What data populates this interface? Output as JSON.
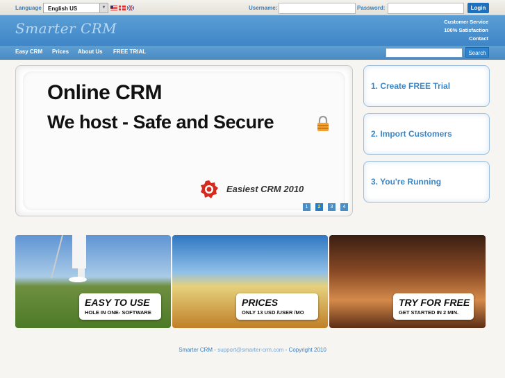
{
  "topbar": {
    "language_label": "Language",
    "language_value": "English US",
    "username_label": "Username:",
    "password_label": "Password:",
    "login_label": "Login"
  },
  "header": {
    "logo_text": "Smarter CRM",
    "links": [
      "Customer Service",
      "100% Satisfaction",
      "Contact"
    ]
  },
  "nav": {
    "items": [
      "Easy CRM",
      "Prices",
      "About Us",
      "FREE TRIAL"
    ],
    "search_label": "Search"
  },
  "slider": {
    "headline1": "Online CRM",
    "headline2": "We host - Safe and Secure",
    "tagline": "Easiest CRM 2010",
    "pages": [
      "1",
      "2",
      "3",
      "4"
    ],
    "active_page": 2
  },
  "steps": [
    "1. Create FREE Trial",
    "2. Import Customers",
    "3. You're Running"
  ],
  "panels": [
    {
      "title": "EASY TO USE",
      "subtitle": "HOLE IN ONE- SOFTWARE"
    },
    {
      "title": "PRICES",
      "subtitle": "ONLY 13 USD /USER /MO"
    },
    {
      "title": "TRY FOR FREE",
      "subtitle": "GET STARTED IN 2 MIN."
    }
  ],
  "footer": {
    "brand": "Smarter CRM",
    "sep1": " - ",
    "email": "support@smarter-crm.com",
    "sep2": " - ",
    "copyright": "Copyright 2010"
  },
  "colors": {
    "brand_blue": "#3f86c8",
    "nav_blue": "#4a8bc4",
    "step_text": "#3b86c6"
  }
}
